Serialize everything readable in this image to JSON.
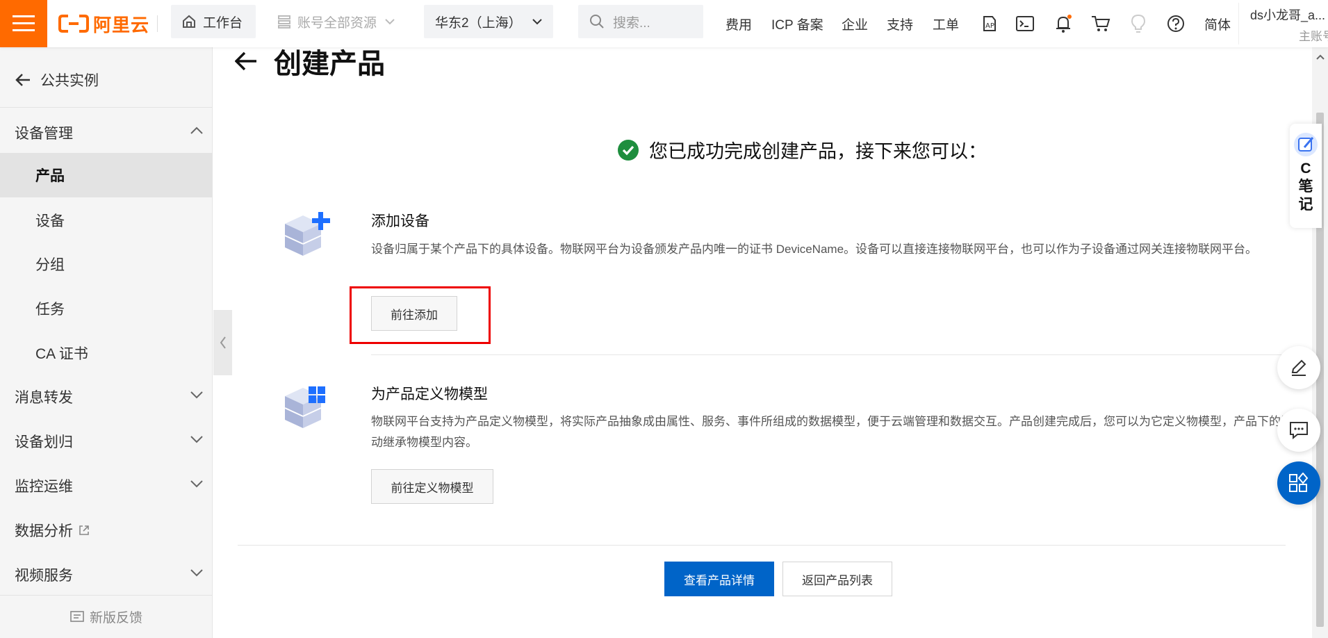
{
  "topbar": {
    "logo_text": "阿里云",
    "workbench": "工作台",
    "account_resources": "账号全部资源",
    "region": "华东2（上海）",
    "search_placeholder": "搜索...",
    "nav": [
      "费用",
      "ICP 备案",
      "企业",
      "支持",
      "工单"
    ],
    "language": "简体",
    "user_name": "ds小龙哥_a...",
    "user_role": "主账号"
  },
  "sidebar": {
    "back_label": "公共实例",
    "groups": [
      {
        "label": "设备管理",
        "expanded": true
      },
      {
        "label": "消息转发"
      },
      {
        "label": "设备划归"
      },
      {
        "label": "监控运维"
      },
      {
        "label": "数据分析"
      },
      {
        "label": "视频服务"
      }
    ],
    "sub_items": [
      "产品",
      "设备",
      "分组",
      "任务",
      "CA 证书"
    ],
    "active_item": "产品",
    "feedback": "新版反馈"
  },
  "main": {
    "title": "创建产品",
    "success_message": "您已成功完成创建产品，接下来您可以：",
    "blocks": [
      {
        "title": "添加设备",
        "desc": "设备归属于某个产品下的具体设备。物联网平台为设备颁发产品内唯一的证书 DeviceName。设备可以直接连接物联网平台，也可以作为子设备通过网关连接物联网平台。",
        "button": "前往添加"
      },
      {
        "title": "为产品定义物模型",
        "desc": "物联网平台支持为产品定义物模型，将实际产品抽象成由属性、服务、事件所组成的数据模型，便于云端管理和数据交互。产品创建完成后，您可以为它定义物模型，产品下的设备将自动继承物模型内容。",
        "button": "前往定义物模型"
      }
    ],
    "primary_button": "查看产品详情",
    "secondary_button": "返回产品列表"
  },
  "widgets": {
    "note_text": [
      "C",
      "笔",
      "记"
    ]
  },
  "colors": {
    "brand": "#ff6a00",
    "primary": "#0064c8",
    "success": "#1e8e3e",
    "highlight": "#e00000"
  }
}
